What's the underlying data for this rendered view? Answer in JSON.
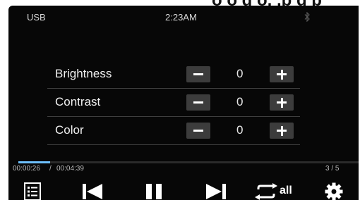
{
  "status_bar": {
    "source": "USB",
    "time": "2:23AM",
    "bluetooth_icon": "bluetooth-icon"
  },
  "top_text": "o o  g  o,  ,p  q p",
  "settings": [
    {
      "label": "Brightness",
      "value": "0"
    },
    {
      "label": "Contrast",
      "value": "0"
    },
    {
      "label": "Color",
      "value": "0"
    }
  ],
  "playback": {
    "elapsed": "00:00:26",
    "separator": "/",
    "duration": "00:04:39",
    "progress_fraction": 0.093,
    "track_counter": "3 / 5",
    "repeat_label": "all"
  },
  "colors": {
    "background": "#070707",
    "accent_progress": "#6ec0ff",
    "button_bg": "#3c3c3c"
  },
  "icons": {
    "list": "list-icon",
    "prev": "skip-previous-icon",
    "pause": "pause-icon",
    "next": "skip-next-icon",
    "repeat": "repeat-icon",
    "settings": "gear-icon"
  }
}
